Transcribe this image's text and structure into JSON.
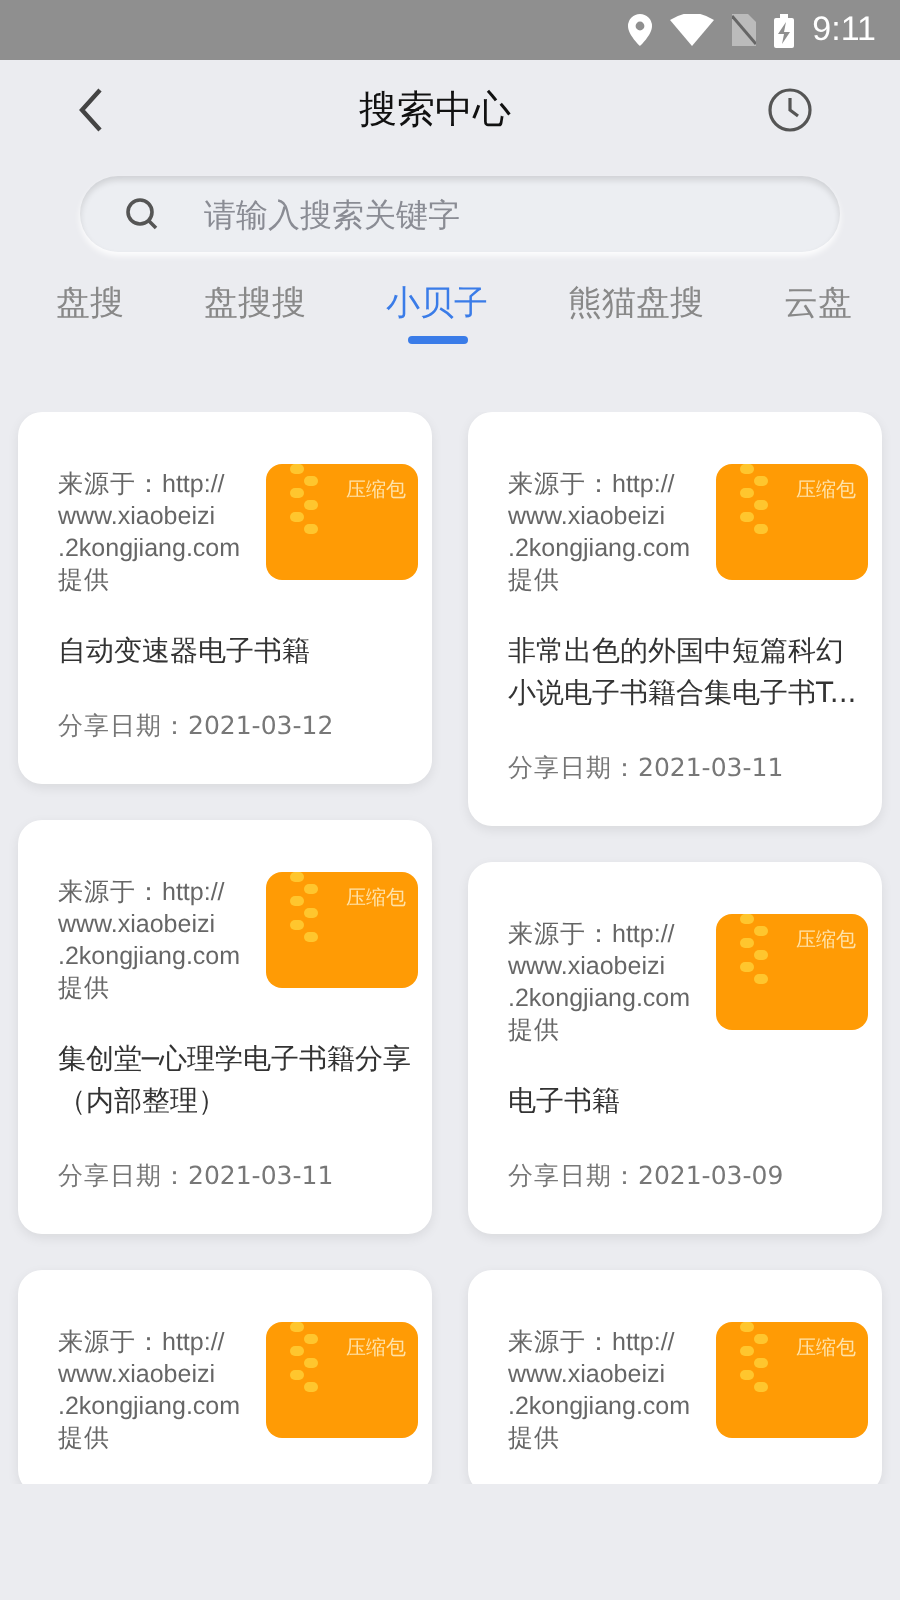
{
  "status_bar": {
    "time": "9:11"
  },
  "header": {
    "title": "搜索中心"
  },
  "search": {
    "placeholder": "请输入搜索关键字"
  },
  "tabs": [
    {
      "label": "盘搜",
      "selected": false
    },
    {
      "label": "盘搜搜",
      "selected": false
    },
    {
      "label": "小贝子",
      "selected": true
    },
    {
      "label": "熊猫盘搜",
      "selected": false
    },
    {
      "label": "云盘",
      "selected": false
    }
  ],
  "columns": [
    {
      "cards": [
        {
          "source_lines": [
            "来源于：http://",
            "www.xiaobeizi",
            ".2kongjiang.com",
            "提供"
          ],
          "thumb_label": "压缩包",
          "title": "自动变速器电子书籍",
          "date": "分享日期：2021-03-12"
        },
        {
          "source_lines": [
            "来源于：http://",
            "www.xiaobeizi",
            ".2kongjiang.com",
            "提供"
          ],
          "thumb_label": "压缩包",
          "title": "集创堂─心理学电子书籍分享（内部整理）",
          "date": "分享日期：2021-03-11"
        },
        {
          "source_lines": [
            "来源于：http://",
            "www.xiaobeizi",
            ".2kongjiang.com",
            "提供"
          ],
          "thumb_label": "压缩包"
        }
      ]
    },
    {
      "cards": [
        {
          "source_lines": [
            "来源于：http://",
            "www.xiaobeizi",
            ".2kongjiang.com",
            "提供"
          ],
          "thumb_label": "压缩包",
          "title": "非常出色的外国中短篇科幻小说电子书籍合集电子书T...",
          "date": "分享日期：2021-03-11"
        },
        {
          "source_lines": [
            "来源于：http://",
            "www.xiaobeizi",
            ".2kongjiang.com",
            "提供"
          ],
          "thumb_label": "压缩包",
          "title": "电子书籍",
          "date": "分享日期：2021-03-09"
        },
        {
          "source_lines": [
            "来源于：http://",
            "www.xiaobeizi",
            ".2kongjiang.com",
            "提供"
          ],
          "thumb_label": "压缩包"
        }
      ]
    }
  ]
}
